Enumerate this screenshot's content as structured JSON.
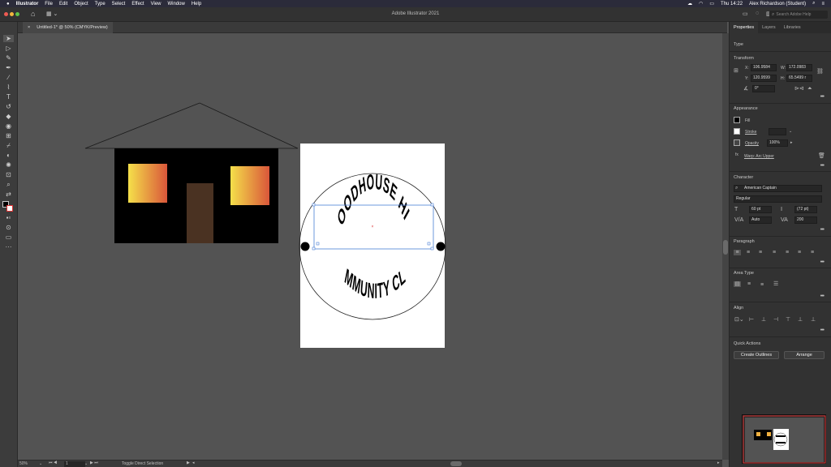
{
  "menubar": {
    "app": "Illustrator",
    "items": [
      "File",
      "Edit",
      "Object",
      "Type",
      "Select",
      "Effect",
      "View",
      "Window",
      "Help"
    ],
    "time": "Thu 14:22",
    "user": "Alex Richardson (Student)"
  },
  "appbar": {
    "title": "Adobe Illustrator 2021",
    "search_placeholder": "Search Adobe Help"
  },
  "document": {
    "tab_label": "Untitled-1* @ 50% (CMYK/Preview)",
    "close_label": "×"
  },
  "artwork": {
    "top_arc_text": "WOODHOUSE HILL",
    "bottom_arc_text": "COMMUNITY CLUB"
  },
  "status": {
    "zoom": "50%",
    "artboard": "1",
    "tool_hint": "Toggle Direct Selection"
  },
  "panel": {
    "tabs": [
      "Properties",
      "Layers",
      "Libraries"
    ],
    "type_label": "Type",
    "transform": {
      "title": "Transform",
      "x_label": "X:",
      "x": "106.9584",
      "y_label": "Y:",
      "y": "120.9599",
      "w_label": "W:",
      "w": "172.0983",
      "h_label": "H:",
      "h": "65.5499 r",
      "angle": "0°"
    },
    "appearance": {
      "title": "Appearance",
      "fill": "Fill",
      "stroke": "Stroke",
      "opacity": "Opacity",
      "opacity_value": "100%",
      "effect": "Warp: Arc Upper"
    },
    "character": {
      "title": "Character",
      "font": "American Captain",
      "style": "Regular",
      "size": "60 pt",
      "leading": "(72 pt)",
      "kerning": "Auto",
      "tracking": "200"
    },
    "paragraph_title": "Paragraph",
    "area_type_title": "Area Type",
    "align_title": "Align",
    "quick_actions": {
      "title": "Quick Actions",
      "create_outlines": "Create Outlines",
      "arrange": "Arrange"
    }
  },
  "colors": {
    "canvas": "#535353",
    "window_glow_start": "#f5e04a",
    "window_glow_end": "#d9563a",
    "door": "#4a3222",
    "house": "#000000"
  }
}
